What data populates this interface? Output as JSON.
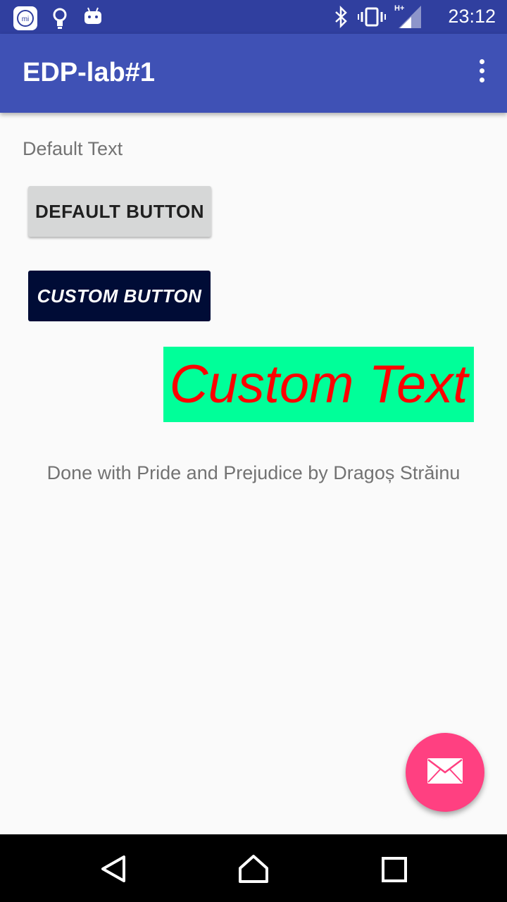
{
  "status_bar": {
    "time": "23:12",
    "icons": [
      "mi-icon",
      "lightbulb-icon",
      "android-icon",
      "bluetooth-icon",
      "vibrate-icon",
      "signal-hplus-icon"
    ],
    "network_label": "H+"
  },
  "app_bar": {
    "title": "EDP-lab#1",
    "overflow_icon": "more-vert-icon"
  },
  "content": {
    "default_text": "Default Text",
    "default_button_label": "DEFAULT BUTTON",
    "custom_button_label": "CUSTOM BUTTON",
    "custom_text": "Custom Text",
    "credit_text": "Done with Pride and Prejudice by Dragoș Străinu"
  },
  "fab": {
    "icon": "mail-icon"
  },
  "nav_bar": {
    "icons": [
      "back-icon",
      "home-icon",
      "recents-icon"
    ]
  },
  "colors": {
    "status_bar": "#303f9f",
    "app_bar": "#3f51b5",
    "custom_button_bg": "#000c36",
    "custom_text_bg": "#00ff99",
    "custom_text_color": "#ff0000",
    "fab": "#ff4081"
  }
}
